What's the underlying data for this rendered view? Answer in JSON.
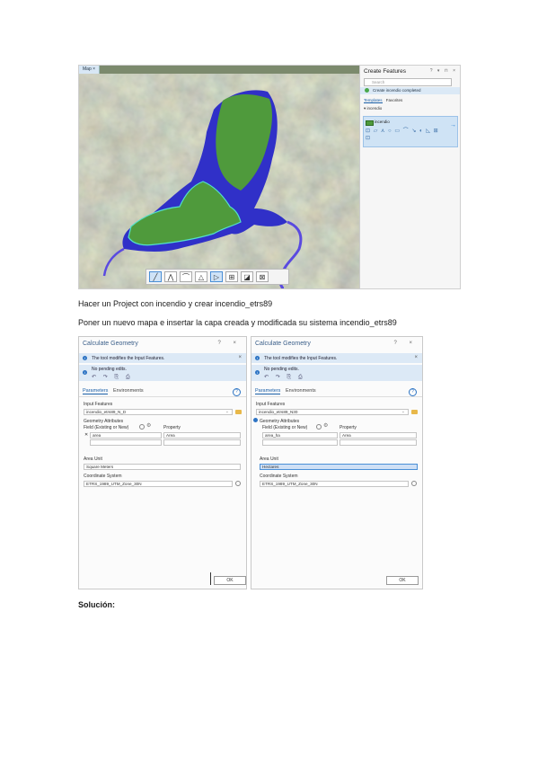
{
  "screenshot1": {
    "map_tab": {
      "label": "Map",
      "close": "×"
    },
    "toolbar": [
      "line-select",
      "vertex",
      "arc",
      "polygon-draw",
      "select",
      "edit-vertices",
      "finish",
      "cancel"
    ],
    "create_features": {
      "title": "Create Features",
      "window_controls": "? ▾ ⊓ ×",
      "search_placeholder": "Search",
      "status": "Create incendio completed",
      "tabs": {
        "templates": "Templates",
        "favorites": "Favorites"
      },
      "group": "▾ incendio",
      "template": "incendio",
      "tools_glyphs": "⊡ ▱ ⋏ ○ ▭ ⌒ ↘ ◐ ◺  ⊞ ⊡",
      "arrow": "→"
    },
    "colors": {
      "polygon": "#4f9a3c",
      "reservoir": "#3a3ad6",
      "outline": "#53e0c8",
      "map_base": "#7c8a6d"
    }
  },
  "text": {
    "line1": "Hacer un Project con incendio y crear incendio_etrs89",
    "line2": "Poner un nuevo mapa e insertar la capa creada y modificada su sistema incendio_etrs89",
    "solution": "Solución:"
  },
  "dialog_left": {
    "title": "Calculate Geometry",
    "controls": "? ×",
    "info1": "The tool modifies the Input Features.",
    "info2": "No pending edits.",
    "info2_icons": "↶ ↷ ⎘ ⎙",
    "close": "×",
    "tab_params": "Parameters",
    "tab_env": "Environments",
    "help": "?",
    "input_features_label": "Input Features",
    "input_features_value": "incendio_etrs89_N_D",
    "geometry_attributes_label": "Geometry Attributes",
    "field_label": "Field (Existing or New)",
    "property_label": "Property",
    "field_value": "area",
    "property_value": "Area",
    "area_unit_label": "Area Unit",
    "area_unit_value": "Square Meters",
    "crs_label": "Coordinate System",
    "crs_value": "ETRS_1989_UTM_Zone_30N",
    "ok": "OK"
  },
  "dialog_right": {
    "title": "Calculate Geometry",
    "controls": "? ×",
    "info1": "The tool modifies the Input Features.",
    "info2": "No pending edits.",
    "info2_icons": "↶ ↷ ⎘ ⎙",
    "close": "×",
    "tab_params": "Parameters",
    "tab_env": "Environments",
    "help": "?",
    "input_features_label": "Input Features",
    "input_features_value": "incendio_etrs89_N30",
    "geometry_attributes_label": "Geometry Attributes",
    "field_label": "Field (Existing or New)",
    "property_label": "Property",
    "field_value": "area_ha",
    "property_value": "Area",
    "area_unit_label": "Area Unit",
    "area_unit_value": "Hectares",
    "crs_label": "Coordinate System",
    "crs_value": "ETRS_1989_UTM_Zone_30N",
    "ok": "OK"
  }
}
